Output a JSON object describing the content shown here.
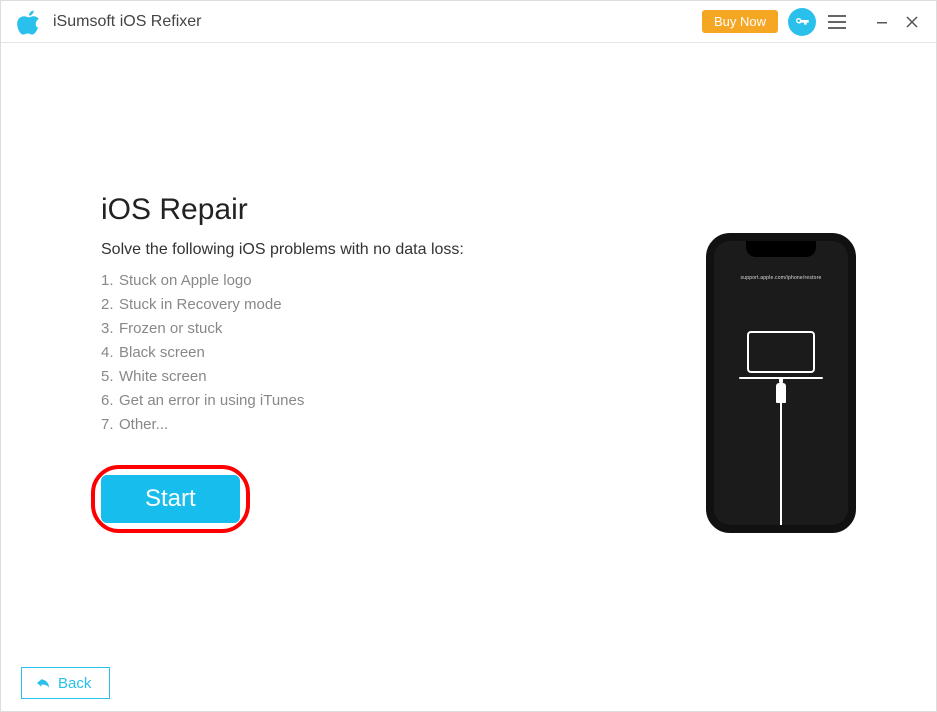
{
  "titlebar": {
    "app_title": "iSumsoft iOS Refixer",
    "buy_now": "Buy Now"
  },
  "main": {
    "heading": "iOS Repair",
    "subheading": "Solve the following iOS problems with no data loss:",
    "problems": [
      "Stuck on Apple logo",
      "Stuck in Recovery mode",
      "Frozen or stuck",
      "Black screen",
      "White screen",
      "Get an error in using iTunes",
      "Other..."
    ],
    "start_label": "Start"
  },
  "phone": {
    "restore_url": "support.apple.com/iphone/restore"
  },
  "footer": {
    "back_label": "Back"
  }
}
